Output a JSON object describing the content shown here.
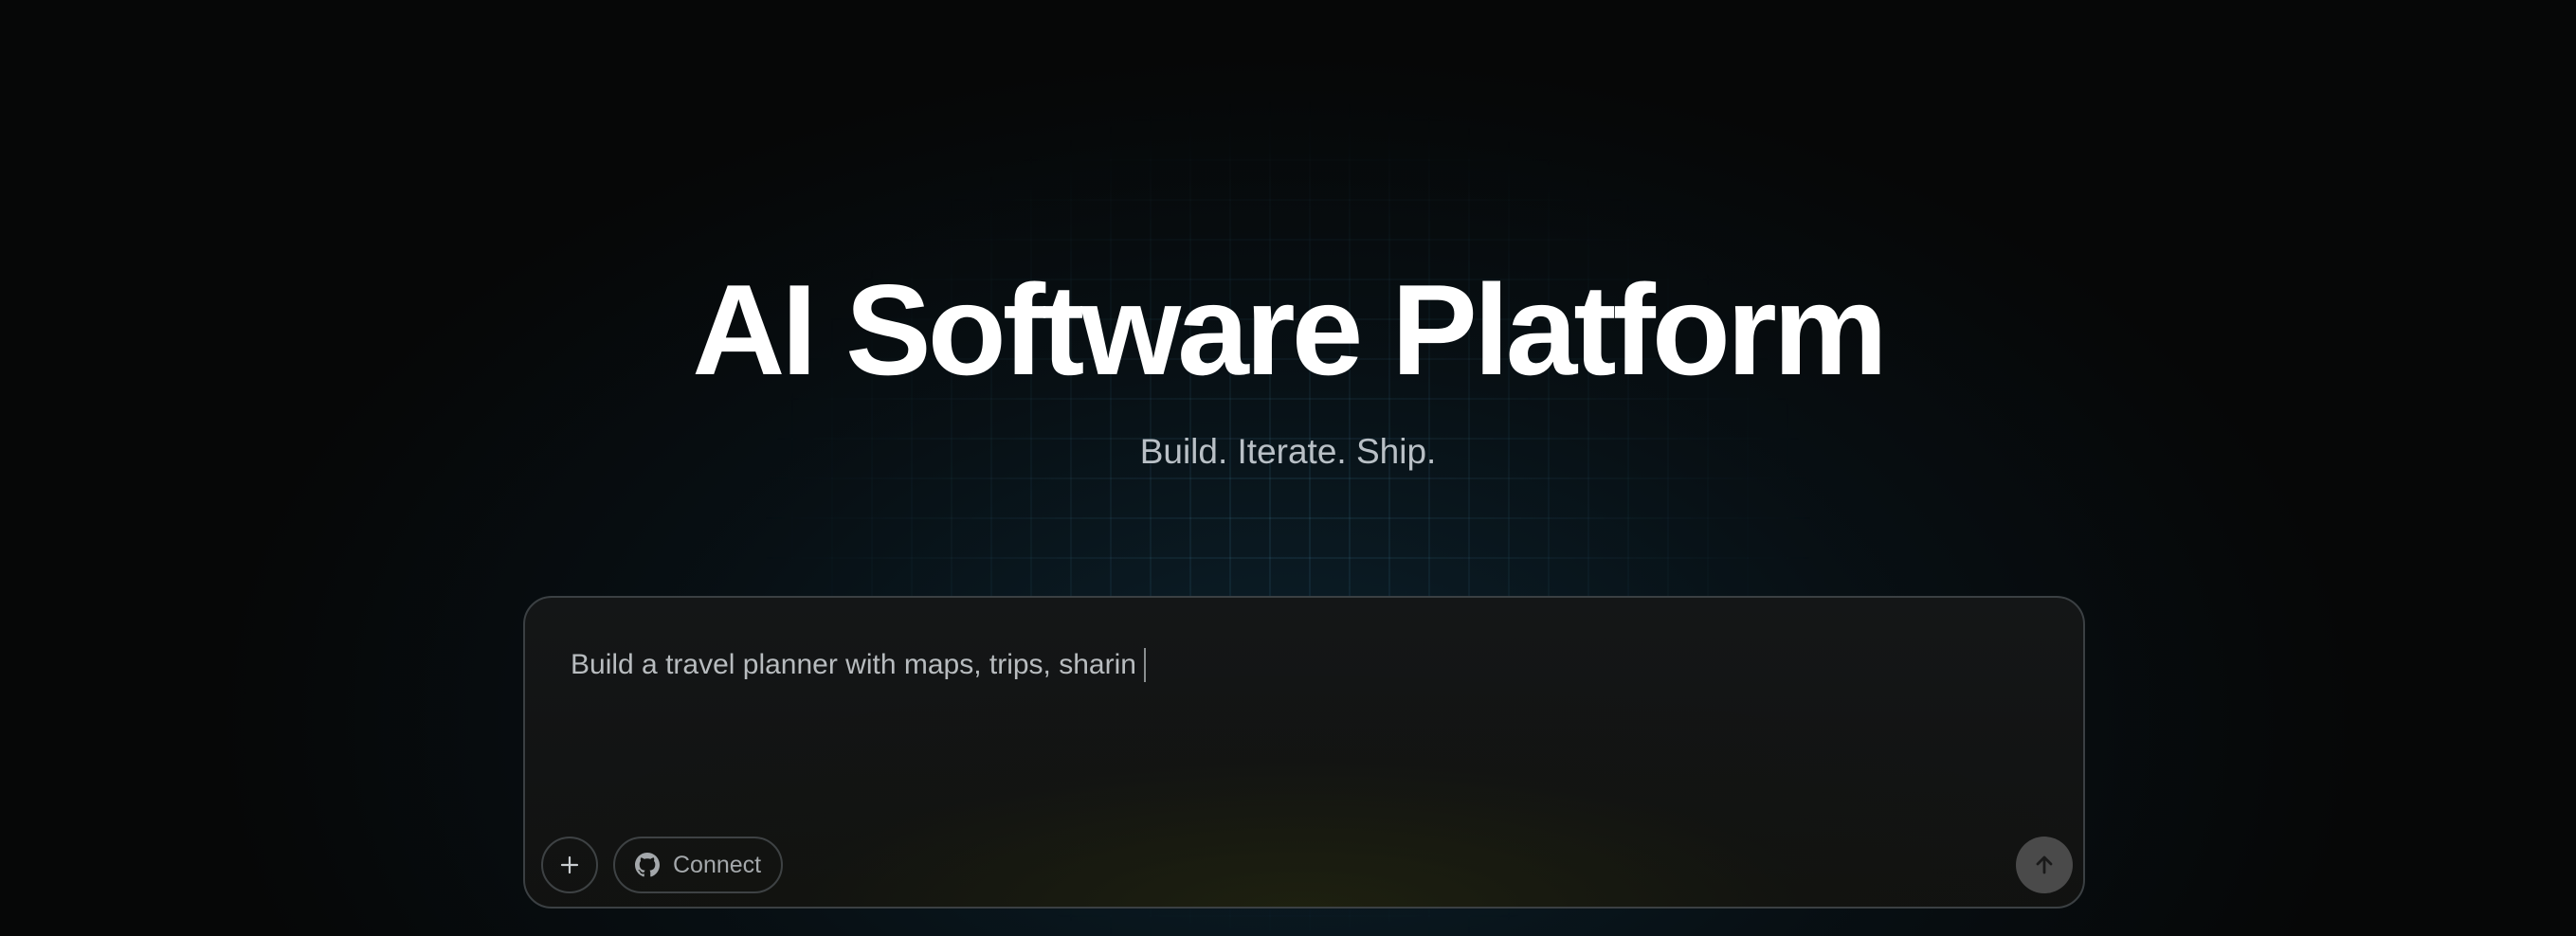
{
  "hero": {
    "title": "AI Software Platform",
    "subtitle": "Build. Iterate. Ship."
  },
  "prompt": {
    "input_value": "Build a travel planner with maps, trips, sharin",
    "attach_icon": "plus-icon",
    "connect_label": "Connect",
    "connect_icon": "github-icon",
    "submit_icon": "arrow-up-icon"
  },
  "colors": {
    "background": "#060707",
    "title": "#ffffff",
    "subtitle": "#b9c0c6",
    "prompt_border": "#3b4043",
    "send_button": "#4a4a4a"
  }
}
